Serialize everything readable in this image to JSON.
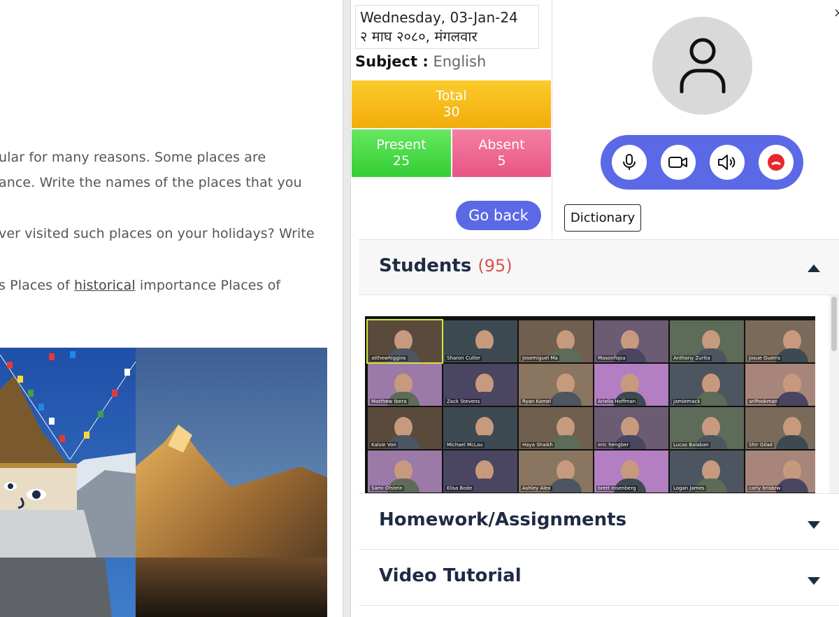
{
  "reading": {
    "line1": "ular for many reasons. Some places are",
    "line2": "ance. Write the names of the places that you",
    "line3": "ver visited such places on your holidays? Write",
    "line4_pre": "s Places of ",
    "line4_link": "historical",
    "line4_post": " importance Places of"
  },
  "class_info": {
    "date_en": "Wednesday, 03-Jan-24",
    "date_np": "२ माघ २०८०, मंगलवार",
    "subject_label": "Subject :",
    "subject_value": "English",
    "total_label": "Total",
    "total_value": "30",
    "present_label": "Present",
    "present_value": "25",
    "absent_label": "Absent",
    "absent_value": "5",
    "go_back_label": "Go back"
  },
  "call": {
    "close_label": "×",
    "dictionary_label": "Dictionary",
    "icons": [
      "user-icon",
      "microphone-icon",
      "camera-icon",
      "speaker-icon",
      "hang-up-icon"
    ]
  },
  "students": {
    "title": "Students",
    "count": "(95)",
    "tiles": [
      {
        "name": "atthewhiggins"
      },
      {
        "name": "Sharon Cutler"
      },
      {
        "name": "Josemiguel Ma"
      },
      {
        "name": "Masonfiqsa"
      },
      {
        "name": "Anthony Zurita"
      },
      {
        "name": "Josue Guerra"
      },
      {
        "name": "Matthew Ibera"
      },
      {
        "name": "Zack Stevens"
      },
      {
        "name": "Ryan Kamel"
      },
      {
        "name": "Ariella Hoffman"
      },
      {
        "name": "Jamiemack"
      },
      {
        "name": "ariPookman"
      },
      {
        "name": "Kalsie Von"
      },
      {
        "name": "Michael McLau"
      },
      {
        "name": "Haya Shaikh"
      },
      {
        "name": "eric hengber"
      },
      {
        "name": "Lucas Balaban"
      },
      {
        "name": "Shir Gilad"
      },
      {
        "name": "Sami Ofstein"
      },
      {
        "name": "Elisa Bode"
      },
      {
        "name": "Ashley Alex"
      },
      {
        "name": "brett rosenberg"
      },
      {
        "name": "Logan James"
      },
      {
        "name": "carly brisbrw"
      }
    ]
  },
  "sections": {
    "homework": "Homework/Assignments",
    "video": "Video Tutorial"
  },
  "colors": {
    "accent": "#5b69e6",
    "total": "#f6b71a",
    "present": "#4cd947",
    "absent": "#ec6a92",
    "heading": "#1f2a44",
    "count": "#d9534f"
  }
}
